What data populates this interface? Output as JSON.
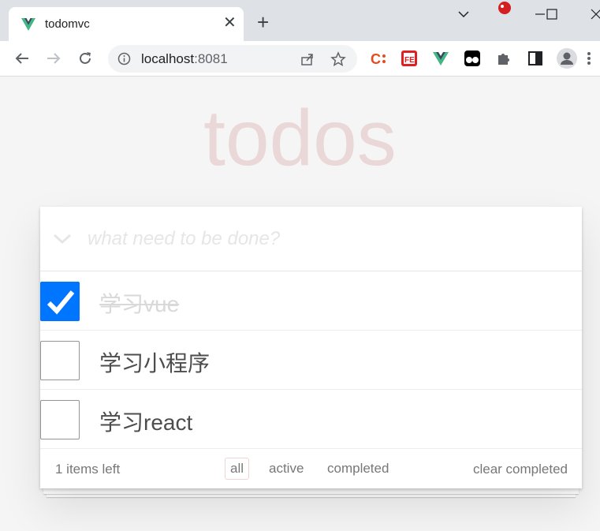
{
  "browser": {
    "tab_title": "todomvc",
    "url_host": "localhost",
    "url_port": ":8081",
    "icons": [
      "vue-logo-icon",
      "close-icon",
      "plus-icon",
      "chevron-down-icon",
      "minimize-icon",
      "maximize-icon",
      "close-window-icon",
      "back-icon",
      "forward-icon",
      "reload-icon",
      "info-icon",
      "share-icon",
      "star-icon",
      "puzzle-icon",
      "side-panel-icon",
      "profile-icon",
      "menu-icon"
    ]
  },
  "app": {
    "title": "todos",
    "input_placeholder": "what need to be done?"
  },
  "todos": [
    {
      "label": "学习vue",
      "completed": true
    },
    {
      "label": "学习小程序",
      "completed": false
    },
    {
      "label": "学习react",
      "completed": false
    }
  ],
  "footer": {
    "count_text": "1 items left",
    "filters": [
      {
        "label": "all",
        "selected": true
      },
      {
        "label": "active",
        "selected": false
      },
      {
        "label": "completed",
        "selected": false
      }
    ],
    "clear_label": "clear completed"
  },
  "colors": {
    "title": "#e8d2d2",
    "checkbox_checked": "#0075ff",
    "vue_green": "#41b883"
  }
}
